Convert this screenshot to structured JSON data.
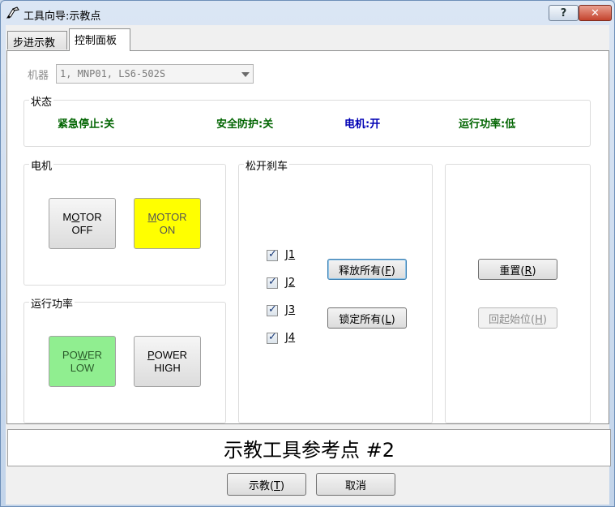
{
  "window": {
    "title": "工具向导:示教点",
    "help_label": "?",
    "close_label": "✕"
  },
  "tabs": [
    {
      "label": "步进示教"
    },
    {
      "label": "控制面板"
    }
  ],
  "robot": {
    "label": "机器",
    "value": "1, MNP01, LS6-502S"
  },
  "status": {
    "title": "状态",
    "items": [
      {
        "label": "紧急停止:关",
        "color": "#006400"
      },
      {
        "label": "安全防护:关",
        "color": "#006400"
      },
      {
        "label": "电机:开",
        "color": "#0000b4"
      },
      {
        "label": "运行功率:低",
        "color": "#006400"
      }
    ]
  },
  "motor": {
    "title": "电机",
    "off": {
      "line1_hot": "M",
      "line1_ul": "O",
      "line1_rest": "TOR",
      "line2": "OFF"
    },
    "on": {
      "line1_ul": "M",
      "line1_rest": "OTOR",
      "line2": "ON",
      "color": "#ffff00"
    }
  },
  "power": {
    "title": "运行功率",
    "low": {
      "line1_a": "PO",
      "line1_ul": "W",
      "line1_b": "ER",
      "line2": "LOW",
      "color": "#90ee90"
    },
    "high": {
      "line1_ul": "P",
      "line1_rest": "OWER",
      "line2": "HIGH"
    }
  },
  "brake": {
    "title": "松开刹车",
    "joints": [
      {
        "label_main": "J",
        "label_ul": "1"
      },
      {
        "label_main": "J",
        "label_ul": "2"
      },
      {
        "label_main": "J",
        "label_ul": "3"
      },
      {
        "label_main": "J",
        "label_ul": "4"
      }
    ],
    "release_all": {
      "text": "释放所有(",
      "ul": "F",
      "end": ")"
    },
    "lock_all": {
      "text": "锁定所有(",
      "ul": "L",
      "end": ")"
    }
  },
  "right_panel": {
    "reset": {
      "text": "重置(",
      "ul": "R",
      "end": ")"
    },
    "home": {
      "text": "回起始位(",
      "ul": "H",
      "end": ")"
    }
  },
  "reference_point": "示教工具参考点 #2",
  "footer": {
    "teach": {
      "text": "示教(",
      "ul": "T",
      "end": ")"
    },
    "cancel_label": "取消"
  }
}
